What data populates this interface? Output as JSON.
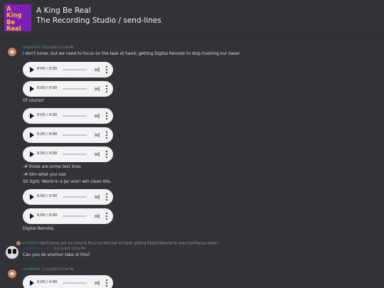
{
  "server": {
    "logo_lines": [
      "A",
      "King",
      "Be",
      "Real"
    ],
    "name": "A King Be Real",
    "channel_path": "The Recording Studio / send-lines"
  },
  "player": {
    "time": "0:00 / 0:00"
  },
  "messages": [
    {
      "username": "ano6464",
      "timestamp": "11/11/2025 12:49 PM",
      "lines": [
        "I don't know, but we need to focus on the task at hand; getting Digital Remote to stop trashing our base!",
        "Of course!",
        "-# those are some test lines",
        "-# idm what you use",
        "Sit tight; World in a Jar and I will clean this.",
        "Digital Remote."
      ]
    },
    {
      "reply_to": {
        "username": "ano6464",
        "text": "I don't know, but we need to focus on the task at hand; getting Digital Remote to stop trashing our base!"
      },
      "username": "digitalcoven93",
      "timestamp": "11/11/2025 12:54 PM",
      "lines": [
        "Can you do another take of this?"
      ]
    },
    {
      "username": "ano6464",
      "timestamp": "11/11/2025 12:54 PM",
      "lines": []
    }
  ],
  "colors": {
    "background": "#313338",
    "username_green": "#4f8a74",
    "username_purple": "#553a7a",
    "logo_bg": "#7d1fb8",
    "logo_text": "#f6c614"
  }
}
